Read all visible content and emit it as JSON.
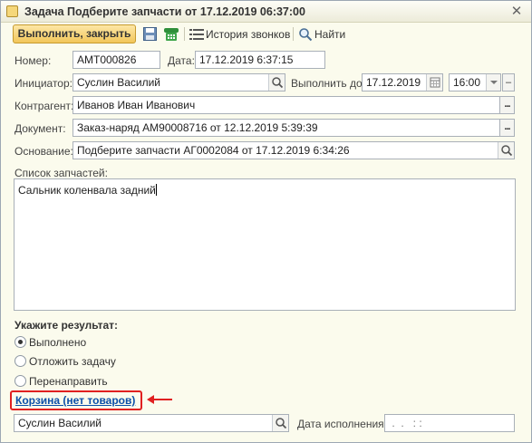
{
  "window": {
    "title": "Задача Подберите запчасти от 17.12.2019 06:37:00"
  },
  "toolbar": {
    "execute_close": "Выполнить, закрыть",
    "save_icon": "save-icon",
    "phone_icon": "phone-icon",
    "call_history": "История звонков",
    "find": "Найти"
  },
  "form": {
    "number_label": "Номер:",
    "number_value": "АМТ000826",
    "date_label": "Дата:",
    "date_value": "17.12.2019  6:37:15",
    "initiator_label": "Инициатор:",
    "initiator_value": "Суслин Василий",
    "due_label": "Выполнить до:",
    "due_date": "17.12.2019",
    "due_time": "16:00",
    "counterparty_label": "Контрагент:",
    "counterparty_value": "Иванов Иван Иванович",
    "document_label": "Документ:",
    "document_value": "Заказ-наряд АМ90008716 от 12.12.2019 5:39:39",
    "basis_label": "Основание:",
    "basis_value": "Подберите запчасти АГ0002084 от 17.12.2019 6:34:26",
    "parts_list_label": "Список запчастей:",
    "parts_list_value": "Сальник коленвала задний"
  },
  "result": {
    "heading": "Укажите результат:",
    "options": [
      {
        "label": "Выполнено",
        "checked": true
      },
      {
        "label": "Отложить задачу",
        "checked": false
      },
      {
        "label": "Перенаправить",
        "checked": false
      }
    ]
  },
  "cart": {
    "link": "Корзина (нет товаров)"
  },
  "assignee": {
    "value": "Суслин Василий",
    "completion_date_label": "Дата исполнения:",
    "completion_date_placeholder": " .  .   : :"
  },
  "colors": {
    "accent_button": "#f2c65a",
    "link": "#0b4fa8",
    "highlight": "#e02020",
    "background": "#fbfbed"
  }
}
